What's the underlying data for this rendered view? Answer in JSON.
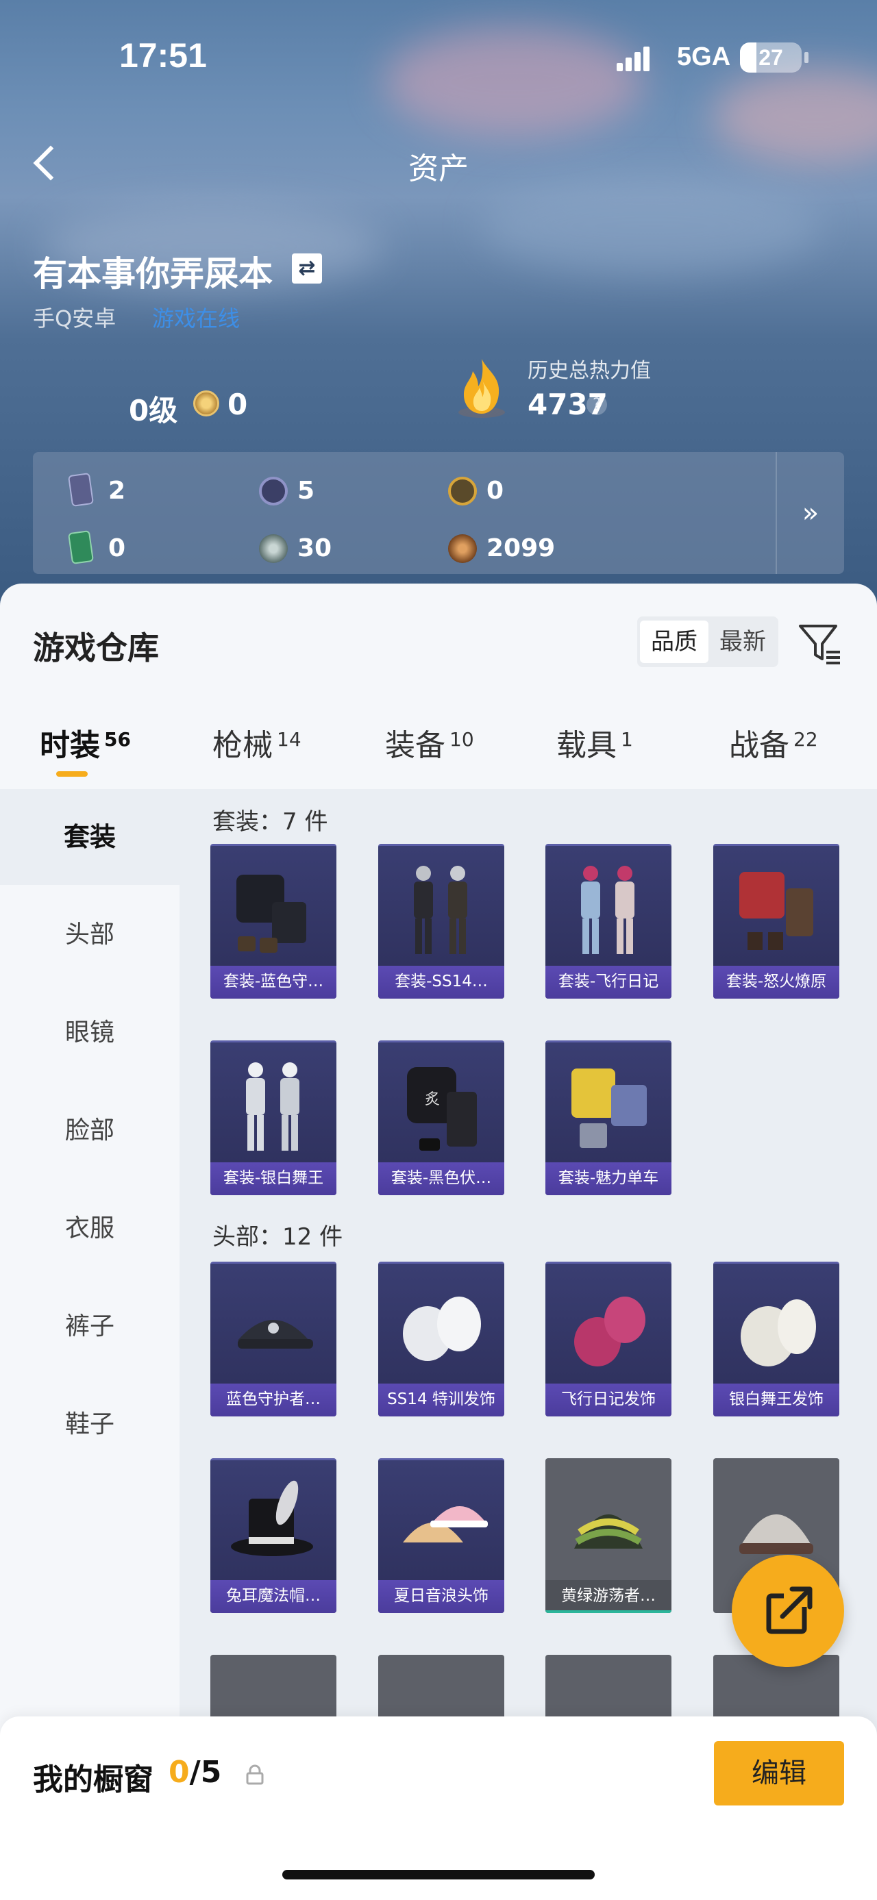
{
  "status_bar": {
    "time": "17:51",
    "network": "5GA",
    "battery": "27",
    "battery_fraction": 0.27
  },
  "nav": {
    "title": "资产",
    "back_icon": "chevron-left-icon"
  },
  "profile": {
    "username": "有本事你弄屎本",
    "switch_icon": "swap-icon",
    "platform": "手Q安卓",
    "online_status": "游戏在线",
    "level": "0级",
    "medal_value": "0",
    "heat_label": "历史总热力值",
    "heat_value": "4737",
    "help_symbol": "?"
  },
  "resources": [
    {
      "icon": "card-icon",
      "value": "2",
      "color": "#5b5f8c"
    },
    {
      "icon": "coin-icon",
      "value": "5",
      "color": "#6a6fa8"
    },
    {
      "icon": "token-icon",
      "value": "0",
      "color": "#d7a53a"
    },
    {
      "icon": "ticket-icon",
      "value": "0",
      "color": "#2f8a5a"
    },
    {
      "icon": "orb-icon",
      "value": "30",
      "color": "#8aa3a0"
    },
    {
      "icon": "badge-icon",
      "value": "2099",
      "color": "#c07a3a"
    }
  ],
  "resources_more": "»",
  "warehouse": {
    "title": "游戏仓库",
    "sort": {
      "quality": "品质",
      "latest": "最新"
    },
    "tabs": [
      {
        "label": "时装",
        "count": "56"
      },
      {
        "label": "枪械",
        "count": "14"
      },
      {
        "label": "装备",
        "count": "10"
      },
      {
        "label": "载具",
        "count": "1"
      },
      {
        "label": "战备",
        "count": "22"
      }
    ],
    "side": [
      "套装",
      "头部",
      "眼镜",
      "脸部",
      "衣服",
      "裤子",
      "鞋子"
    ],
    "sections": [
      {
        "title": "套装：7 件",
        "items": [
          {
            "label": "套装-蓝色守…",
            "rarity": "purple",
            "art": "black-jacket"
          },
          {
            "label": "套装-SS14…",
            "rarity": "purple",
            "art": "dark-duo"
          },
          {
            "label": "套装-飞行日记",
            "rarity": "purple",
            "art": "pink-duo"
          },
          {
            "label": "套装-怒火燎原",
            "rarity": "purple",
            "art": "red-set"
          },
          {
            "label": "套装-银白舞王",
            "rarity": "purple",
            "art": "silver-duo"
          },
          {
            "label": "套装-黑色伏…",
            "rarity": "purple",
            "art": "black-hoodie"
          },
          {
            "label": "套装-魅力单车",
            "rarity": "purple",
            "art": "yellow-set"
          }
        ]
      },
      {
        "title": "头部：12 件",
        "items": [
          {
            "label": "蓝色守护者…",
            "rarity": "purple",
            "art": "cap"
          },
          {
            "label": "SS14 特训发饰",
            "rarity": "purple",
            "art": "white-hair"
          },
          {
            "label": "飞行日记发饰",
            "rarity": "purple",
            "art": "pink-hair"
          },
          {
            "label": "银白舞王发饰",
            "rarity": "purple",
            "art": "silver-hair"
          },
          {
            "label": "兔耳魔法帽…",
            "rarity": "purple",
            "art": "top-hat"
          },
          {
            "label": "夏日音浪头饰",
            "rarity": "purple",
            "art": "pink-caps"
          },
          {
            "label": "黄绿游荡者…",
            "rarity": "grey",
            "art": "beanie"
          },
          {
            "label": "",
            "rarity": "grey",
            "art": "helmet"
          },
          {
            "label": "",
            "rarity": "grey",
            "art": "zebra"
          },
          {
            "label": "",
            "rarity": "grey",
            "art": "gold-helm"
          },
          {
            "label": "",
            "rarity": "grey",
            "art": "purple-helm"
          },
          {
            "label": "",
            "rarity": "grey",
            "art": "gold-helm"
          }
        ]
      }
    ]
  },
  "fab_icon": "share-icon",
  "showcase": {
    "label": "我的橱窗",
    "current": "0",
    "total": "/5",
    "lock_icon": "lock-icon",
    "edit_label": "编辑"
  },
  "colors": {
    "accent": "#f6ac1c",
    "link": "#3d8fe8",
    "purple_card": "#4b3c9c"
  }
}
